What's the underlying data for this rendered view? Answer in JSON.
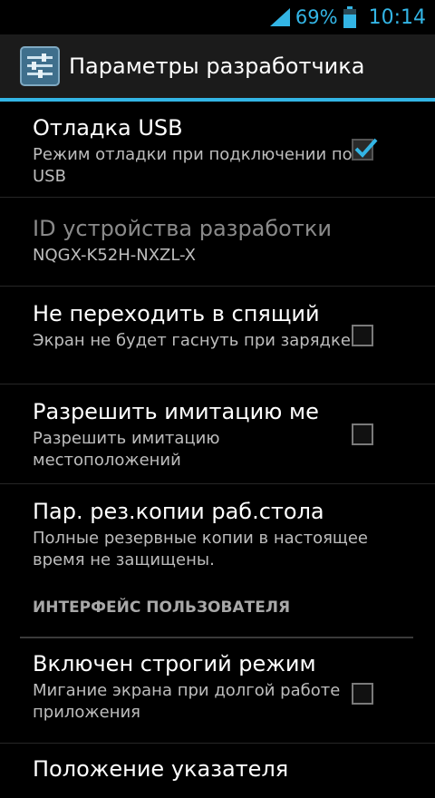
{
  "status_bar": {
    "battery": "69%",
    "time": "10:14"
  },
  "action_bar": {
    "title": "Параметры разработчика"
  },
  "prefs": [
    {
      "title": "Отладка USB",
      "summary": "Режим отладки при подключении по USB",
      "checked": true
    },
    {
      "title": "ID устройства разработки",
      "summary": "NQGX-K52H-NXZL-X"
    },
    {
      "title": "Не переходить в спящий",
      "summary": "Экран не будет гаснуть при зарядке",
      "checked": false
    },
    {
      "title": "Разрешить имитацию ме",
      "summary": "Разрешить имитацию местоположений",
      "checked": false
    },
    {
      "title": "Пар. рез.копии раб.стола",
      "summary": "Полные резервные копии в настоящее время не защищены."
    }
  ],
  "section": {
    "header": "ИНТЕРФЕЙС ПОЛЬЗОВАТЕЛЯ"
  },
  "prefs2": [
    {
      "title": "Включен строгий режим",
      "summary": "Мигание экрана при долгой работе приложения",
      "checked": false
    },
    {
      "title": "Положение указателя"
    }
  ],
  "colors": {
    "accent": "#33b5e5"
  }
}
